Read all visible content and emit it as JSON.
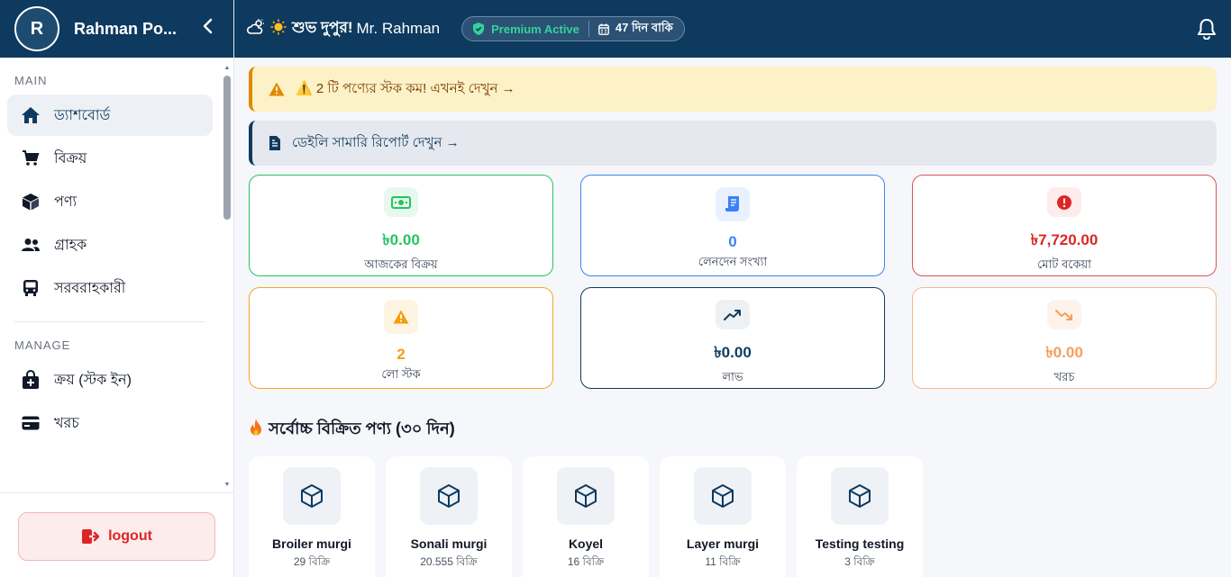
{
  "sidebar": {
    "avatar_letter": "R",
    "shop_name": "Rahman Po...",
    "sections": [
      {
        "label": "MAIN"
      },
      {
        "label": "MANAGE"
      }
    ],
    "items": [
      {
        "label": "ড্যাশবোর্ড",
        "icon": "home-icon",
        "active": true
      },
      {
        "label": "বিক্রয়",
        "icon": "cart-icon"
      },
      {
        "label": "পণ্য",
        "icon": "box-icon"
      },
      {
        "label": "গ্রাহক",
        "icon": "users-icon"
      },
      {
        "label": "সরবরাহকারী",
        "icon": "truck-icon"
      },
      {
        "label": "ক্রয় (স্টক ইন)",
        "icon": "bag-plus-icon"
      },
      {
        "label": "খরচ",
        "icon": "credit-card-icon"
      }
    ],
    "logout_label": "logout"
  },
  "topbar": {
    "greeting": "শুভ দুপুর!",
    "user": "Mr. Rahman",
    "premium_label": "Premium Active",
    "days_label": "47 দিন বাকি"
  },
  "alerts": {
    "low_stock": "⚠️ 2 টি পণ্যের স্টক কম! এখনই দেখুন →",
    "daily_summary": "ডেইলি সামারি রিপোর্ট দেখুন →"
  },
  "stats": [
    {
      "value": "৳0.00",
      "label": "আজকের বিক্রয়",
      "color": "#22c55e",
      "border": "#22c55e",
      "bg": "#e7f8ee",
      "icon": "money-icon"
    },
    {
      "value": "0",
      "label": "লেনদেন সংখ্যা",
      "color": "#3b82f6",
      "border": "#3b82f6",
      "bg": "#e8f1fd",
      "icon": "receipt-icon"
    },
    {
      "value": "৳7,720.00",
      "label": "মোট বকেয়া",
      "color": "#dc2626",
      "border": "#e05252",
      "bg": "#fdecec",
      "icon": "alert-circle-icon"
    },
    {
      "value": "2",
      "label": "লো স্টক",
      "color": "#f59e0b",
      "border": "#f5a623",
      "bg": "#fef4e2",
      "icon": "warning-icon"
    },
    {
      "value": "৳0.00",
      "label": "লাভ",
      "color": "#0e3a5f",
      "border": "#0e3a5f",
      "bg": "#eef1f4",
      "icon": "trend-up-icon"
    },
    {
      "value": "৳0.00",
      "label": "খরচ",
      "color": "#f59e5b",
      "border": "#f8b98a",
      "bg": "#fef3ea",
      "icon": "trend-down-icon"
    }
  ],
  "top_products": {
    "title": "সর্বোচ্চ বিক্রিত পণ্য (৩০ দিন)",
    "items": [
      {
        "name": "Broiler murgi",
        "sold": "29 বিক্রি"
      },
      {
        "name": "Sonali murgi",
        "sold": "20.555 বিক্রি"
      },
      {
        "name": "Koyel",
        "sold": "16 বিক্রি"
      },
      {
        "name": "Layer murgi",
        "sold": "11 বিক্রি"
      },
      {
        "name": "Testing testing",
        "sold": "3 বিক্রি"
      }
    ]
  }
}
